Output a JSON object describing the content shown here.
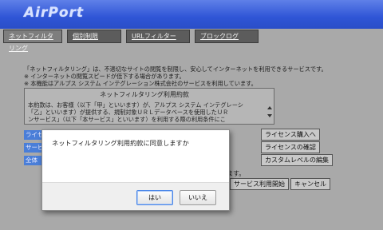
{
  "header": {
    "logo": "AirPort"
  },
  "tabs": [
    {
      "label": "ネットフィルタリング",
      "active": true
    },
    {
      "label": "個別制限",
      "active": false
    },
    {
      "label": "URLフィルター",
      "active": false
    },
    {
      "label": "ブロックログ",
      "active": false
    }
  ],
  "description": {
    "line1": "「ネットフィルタリング」は、不適切なサイトの閲覧を制限し、安心してインターネットを利用できるサービスです。",
    "line2": "※ インターネットの閲覧スピードが低下する場合があります。",
    "line3": "※ 本機能はアルプス システム インテグレーション株式会社のサービスを利用しています。"
  },
  "terms": {
    "title": "ネットフィルタリング利用約款",
    "line1": "本約款は、お客様（以下「甲」といいます）が、アルプス システム インテグレーシ",
    "line2": "「乙」といいます）が提供する、規制対象ＵＲＬデータベースを使用したＵＲ",
    "line3": "ンサービス」（以下「本サービス」といいます）を利用する際の利用条件にこ"
  },
  "left_buttons": [
    "ライセ",
    "サービ",
    "全体"
  ],
  "right_buttons": {
    "buy_license": "ライセンス購入へ",
    "confirm_license": "ライセンスの確認",
    "custom_level": "カスタムレベルの編集",
    "start_service": "サービス利用開始",
    "cancel": "キャンセル"
  },
  "fragment_text": "ます。",
  "dialog": {
    "message": "ネットフィルタリング利用約款に同意しますか",
    "ok": "はい",
    "cancel": "いいえ"
  }
}
